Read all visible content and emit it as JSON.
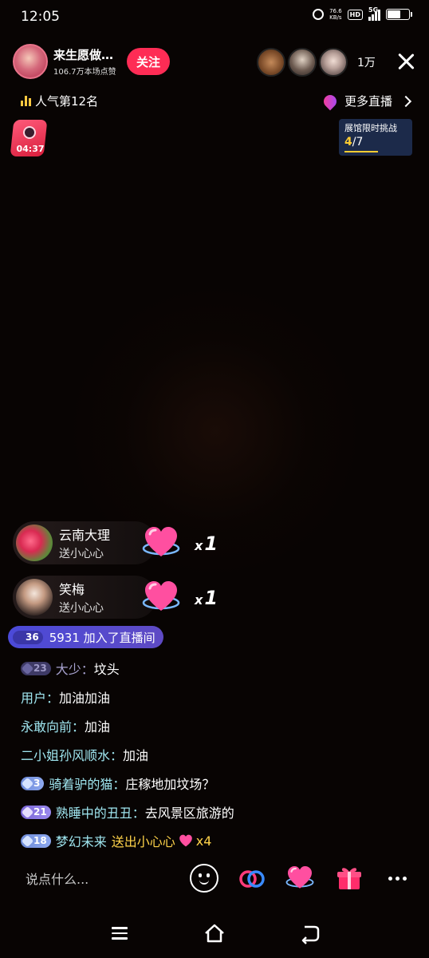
{
  "status_bar": {
    "time": "12:05",
    "net_speed_value": "76.6",
    "net_speed_unit": "KB/s",
    "hd_badge": "HD",
    "network": "5G"
  },
  "host": {
    "name": "来生愿做…",
    "likes": "106.7万本场点赞",
    "follow_label": "关注"
  },
  "viewers": {
    "count": "1万"
  },
  "rank": {
    "label": "人气第12名"
  },
  "more_live": {
    "label": "更多直播"
  },
  "timer": {
    "time": "04:37"
  },
  "challenge": {
    "title": "展馆限时挑战",
    "current": "4",
    "total": "/7"
  },
  "gifts": [
    {
      "user": "云南大理",
      "action": "送小心心",
      "count_prefix": "x",
      "count": "1"
    },
    {
      "user": "笑梅",
      "action": "送小心心",
      "count_prefix": "x",
      "count": "1"
    }
  ],
  "join": {
    "level": "36",
    "text": "5931 加入了直播间"
  },
  "comments": [
    {
      "level": "23",
      "user": "大少：",
      "text": "坟头"
    },
    {
      "user": "用户：",
      "text": "加油加油"
    },
    {
      "user": "永敢向前：",
      "text": "加油"
    },
    {
      "user": "二小姐孙风顺水：",
      "text": "加油"
    },
    {
      "level": "3",
      "user": "骑着驴的猫：",
      "text": "庄稼地加坟场？"
    },
    {
      "level": "21",
      "user": "熟睡中的丑丑：",
      "text": "去风景区旅游的"
    },
    {
      "level": "18",
      "user": "梦幻未来",
      "gift_text": "送出小心心",
      "gift_count": "x4"
    }
  ],
  "input": {
    "placeholder": "说点什么..."
  },
  "colors": {
    "accent": "#fe2c55",
    "comment_user": "#9fe6f0",
    "gift_text": "#ffd34a",
    "join_banner": "#5e4ac4"
  },
  "icons": [
    "alarm-icon",
    "signal-icon",
    "battery-icon",
    "close-icon",
    "bar-chart-icon",
    "location-pin-icon",
    "chevron-right-icon",
    "emoji-icon",
    "link-icon",
    "heart-icon",
    "gift-icon",
    "more-icon",
    "menu-icon",
    "home-icon",
    "back-icon"
  ]
}
